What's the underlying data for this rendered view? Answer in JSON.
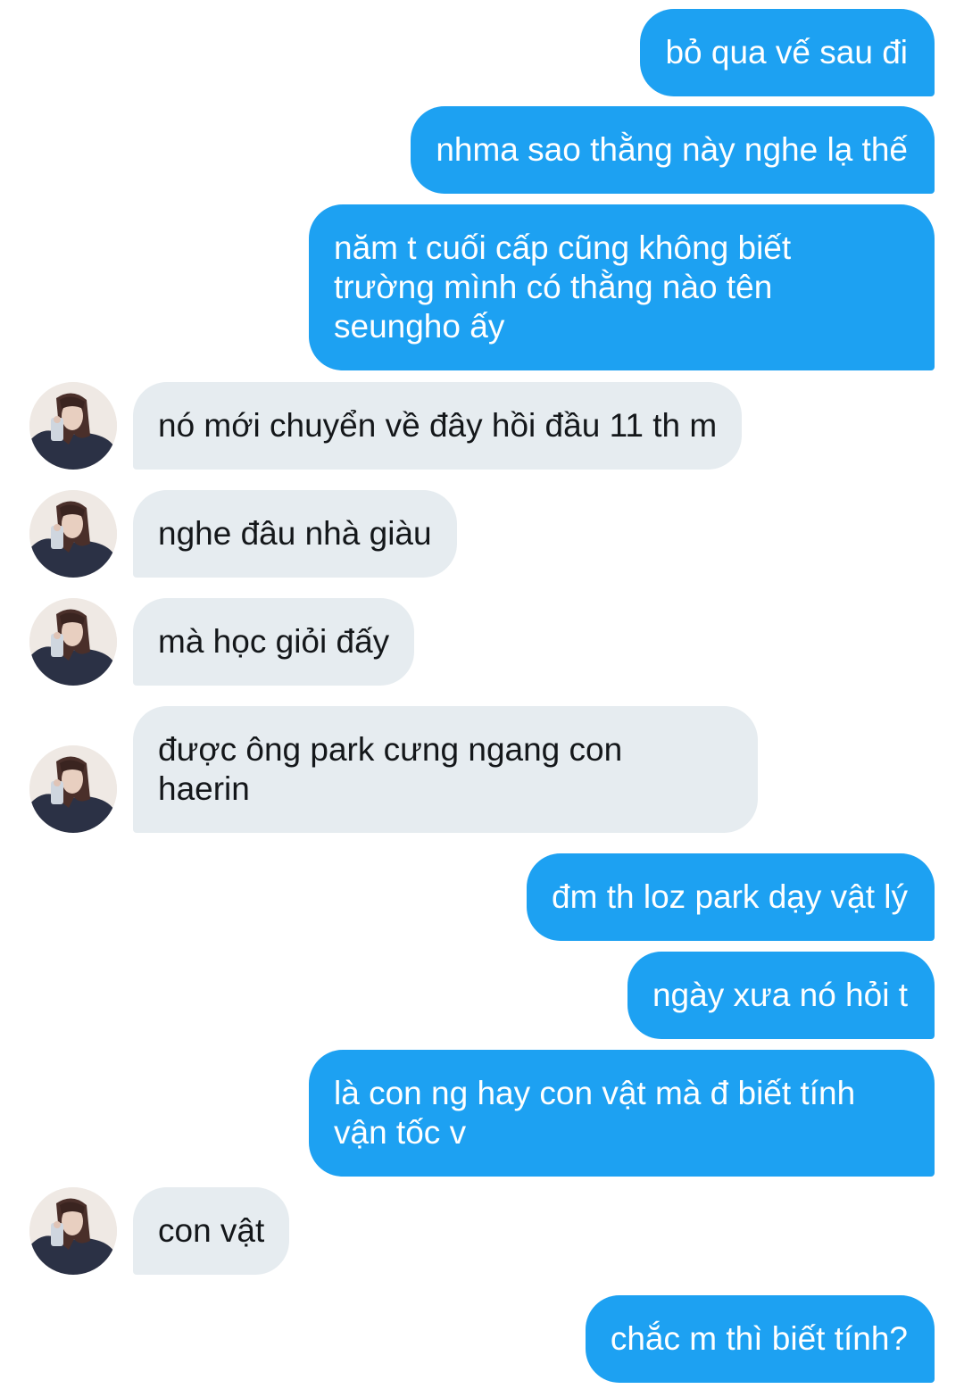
{
  "conversation": {
    "messages": [
      {
        "direction": "outgoing",
        "text": "bỏ qua vế sau đi"
      },
      {
        "direction": "outgoing",
        "text": "nhma sao thằng này nghe lạ thế"
      },
      {
        "direction": "outgoing",
        "text": "năm t cuối cấp cũng không biết\ntrường mình có thằng nào tên\nseungho ấy"
      },
      {
        "direction": "incoming",
        "text": "nó mới chuyển về đây hồi đầu 11 th m"
      },
      {
        "direction": "incoming",
        "text": "nghe đâu nhà giàu"
      },
      {
        "direction": "incoming",
        "text": "mà học giỏi đấy"
      },
      {
        "direction": "incoming",
        "text": "được ông park cưng ngang con\nhaerin"
      },
      {
        "direction": "outgoing",
        "text": "đm th loz park dạy vật lý"
      },
      {
        "direction": "outgoing",
        "text": "ngày xưa nó hỏi t"
      },
      {
        "direction": "outgoing",
        "text": "là con ng hay con vật mà đ biết tính\nvận tốc v"
      },
      {
        "direction": "incoming",
        "text": "con vật"
      },
      {
        "direction": "outgoing",
        "text": "chắc m thì biết tính?"
      }
    ]
  },
  "theme": {
    "outgoing_bubble_color": "#1da1f2",
    "outgoing_text_color": "#ffffff",
    "incoming_bubble_color": "#e6ecf0",
    "incoming_text_color": "#14171a"
  }
}
